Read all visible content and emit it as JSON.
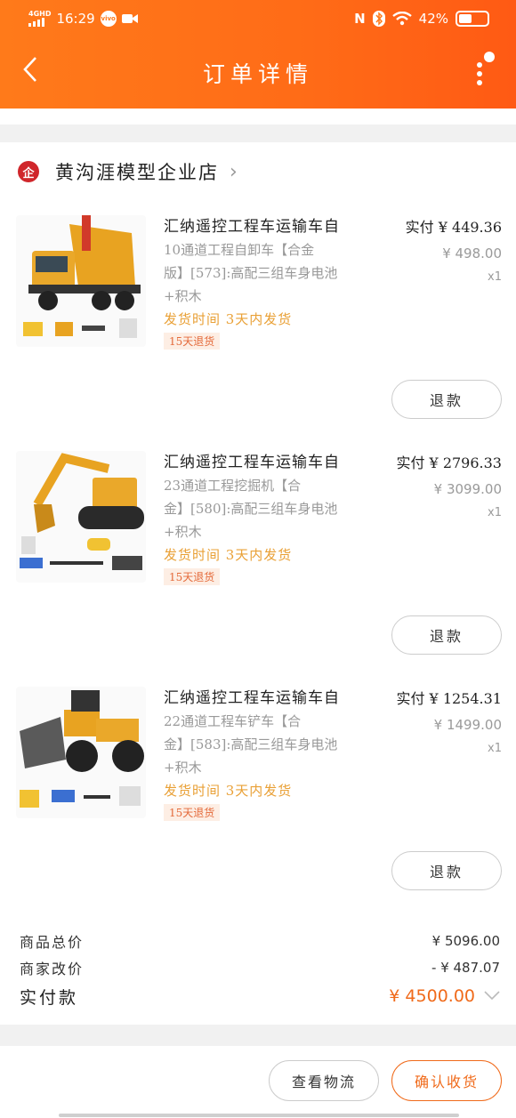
{
  "status_bar": {
    "network": "4GHD",
    "time": "16:29",
    "badge": "vivo",
    "battery": "42%"
  },
  "nav": {
    "back_icon": "back-arrow-icon",
    "title": "订单详情",
    "more_icon": "more-dots-icon"
  },
  "shop": {
    "name": "黄沟涯模型企业店",
    "logo_char": "企"
  },
  "items": [
    {
      "title": "汇纳遥控工程车运输车自",
      "spec_lines": [
        "10通道工程自卸车【合金",
        "版】[573]:高配三组车身电池",
        "+积木"
      ],
      "ship": "发货时间 3天内发货",
      "tag": "15天退货",
      "paid": "实付 ¥ 449.36",
      "orig": "¥ 498.00",
      "qty": "x1",
      "refund": "退款"
    },
    {
      "title": "汇纳遥控工程车运输车自",
      "spec_lines": [
        "23通道工程挖掘机【合",
        "金】[580]:高配三组车身电池",
        "+积木"
      ],
      "ship": "发货时间 3天内发货",
      "tag": "15天退货",
      "paid": "实付 ¥ 2796.33",
      "orig": "¥ 3099.00",
      "qty": "x1",
      "refund": "退款"
    },
    {
      "title": "汇纳遥控工程车运输车自",
      "spec_lines": [
        "22通道工程车铲车【合",
        "金】[583]:高配三组车身电池",
        "+积木"
      ],
      "ship": "发货时间 3天内发货",
      "tag": "15天退货",
      "paid": "实付 ¥ 1254.31",
      "orig": "¥ 1499.00",
      "qty": "x1",
      "refund": "退款"
    }
  ],
  "summary": {
    "goods_total_label": "商品总价",
    "goods_total": "¥ 5096.00",
    "discount_label": "商家改价",
    "discount": "- ¥ 487.07",
    "paid_label": "实付款",
    "paid": "¥ 4500.00"
  },
  "actions": {
    "logistics": "查看物流",
    "confirm": "确认收货"
  },
  "colors": {
    "header": "#ff7a1a",
    "accent": "#f06a1a",
    "ship": "#e9a036",
    "tag_bg": "#fdeee4"
  }
}
